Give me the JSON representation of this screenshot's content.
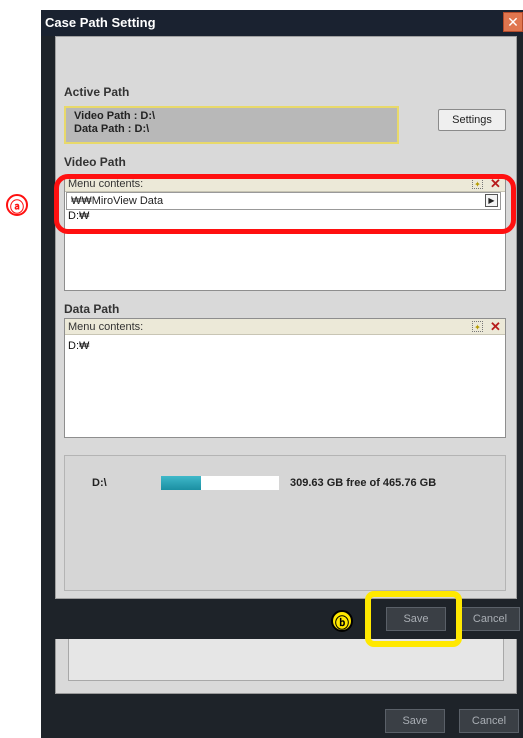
{
  "dialog": {
    "title": "Case Path Setting",
    "close_glyph": "✕"
  },
  "active_path": {
    "label": "Active Path",
    "video_line": "Video Path : D:\\",
    "data_line": "Data Path : D:\\",
    "settings_label": "Settings"
  },
  "video_path": {
    "label": "Video Path",
    "header": "Menu contents:",
    "edit_value": "₩₩MiroView Data",
    "items": [
      "D:₩"
    ]
  },
  "data_path": {
    "label": "Data Path",
    "header": "Menu contents:",
    "items": [
      "D:₩"
    ]
  },
  "drive": {
    "name": "D:\\",
    "free_text": "309.63 GB free of 465.76 GB",
    "usage_fraction": 0.335,
    "bar_color": "#26a3b5"
  },
  "buttons": {
    "save_label": "Save",
    "cancel_label": "Cancel"
  },
  "background_window": {
    "save_label": "Save",
    "cancel_label": "Cancel"
  },
  "annotations": {
    "a": "ⓐ",
    "b": "ⓑ",
    "a_color": "#ff1010",
    "b_color": "#ffe800"
  }
}
